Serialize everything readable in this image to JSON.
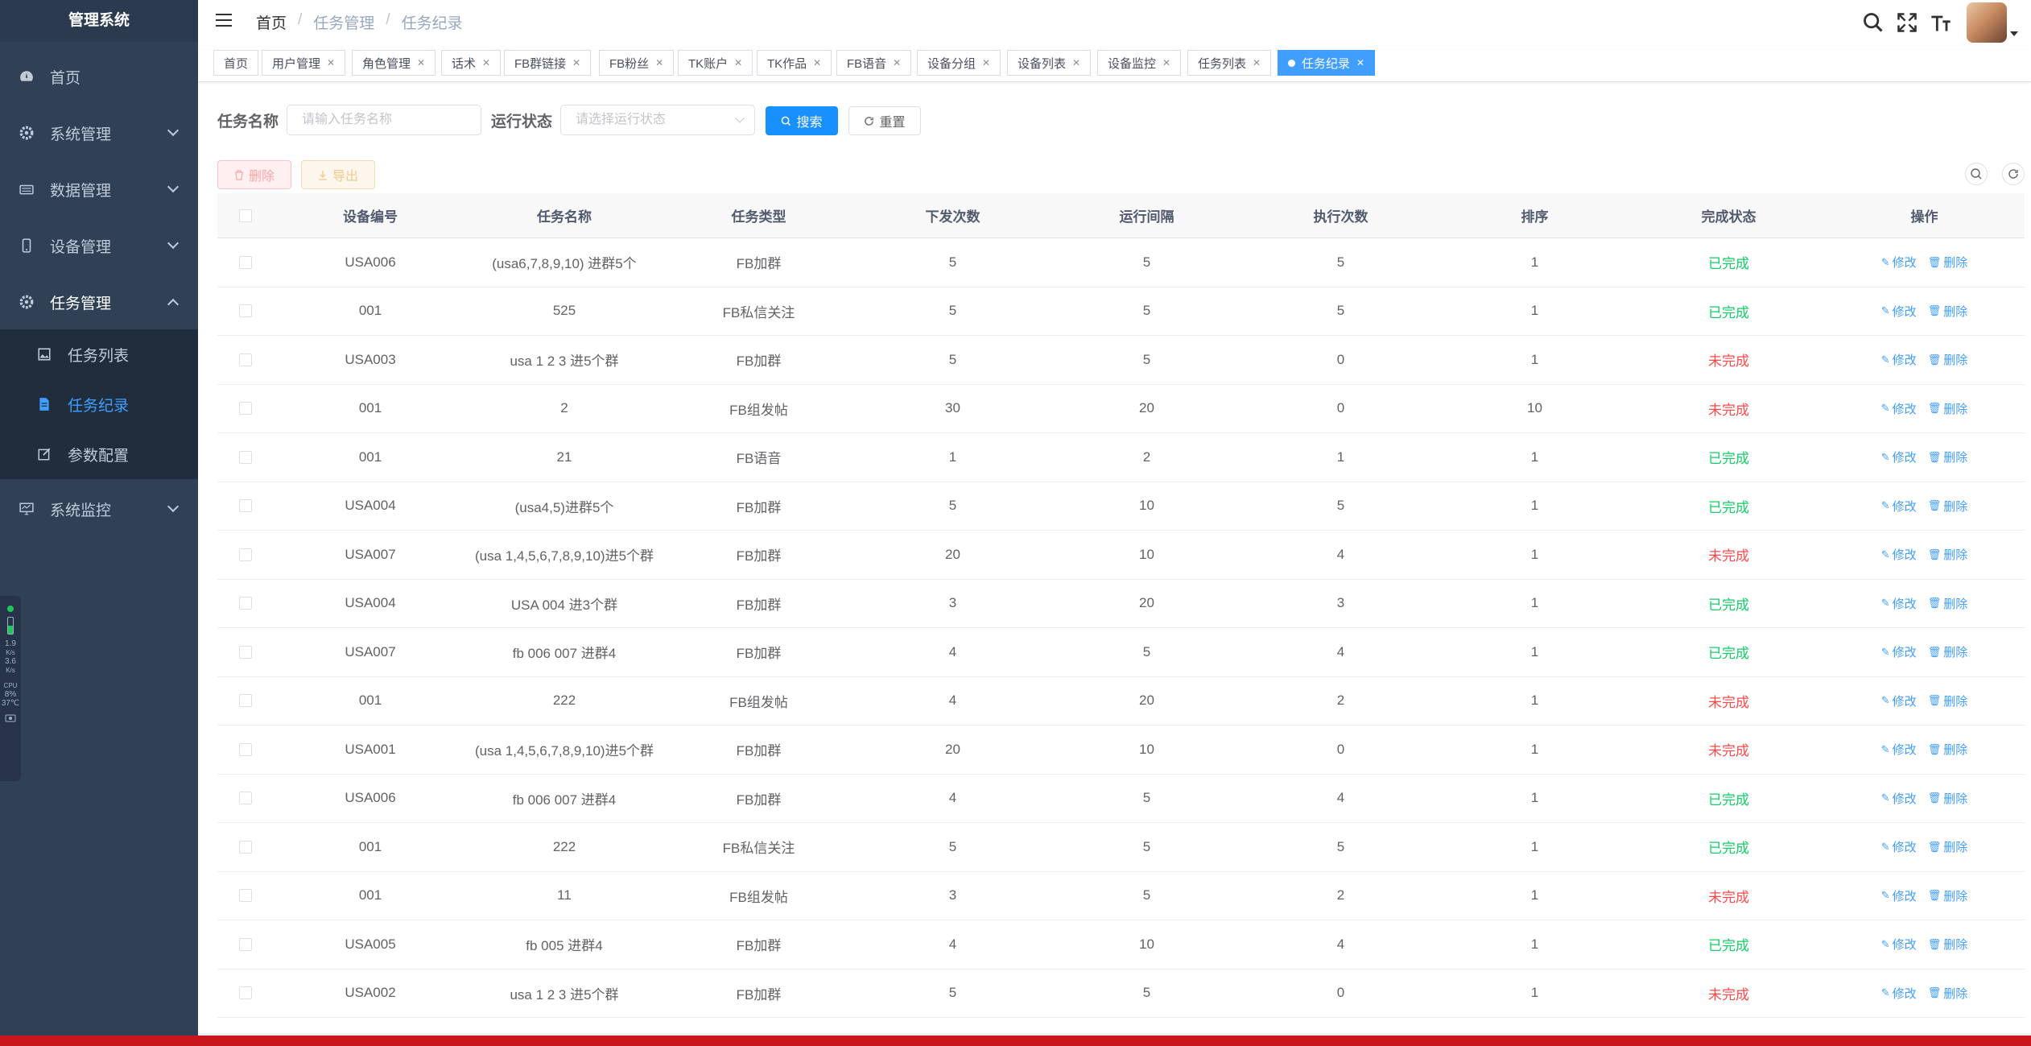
{
  "sidebar": {
    "title": "管理系统",
    "items": [
      {
        "label": "首页",
        "icon": "dashboard-icon"
      },
      {
        "label": "系统管理",
        "icon": "gear-icon"
      },
      {
        "label": "数据管理",
        "icon": "keyboard-icon"
      },
      {
        "label": "设备管理",
        "icon": "phone-icon"
      },
      {
        "label": "任务管理",
        "icon": "gear-icon"
      },
      {
        "label": "系统监控",
        "icon": "monitor-icon"
      }
    ],
    "subitems": [
      {
        "label": "任务列表"
      },
      {
        "label": "任务纪录"
      },
      {
        "label": "参数配置"
      }
    ]
  },
  "widget": {
    "down_speed": "1.9",
    "down_unit": "K/s",
    "up_speed": "3.6",
    "up_unit": "K/s",
    "cpu_label": "CPU",
    "cpu_value": "8%",
    "temp": "37℃"
  },
  "header": {
    "breadcrumb": [
      "首页",
      "任务管理",
      "任务纪录"
    ]
  },
  "tags": [
    "首页",
    "用户管理",
    "角色管理",
    "话术",
    "FB群链接",
    "FB粉丝",
    "TK账户",
    "TK作品",
    "FB语音",
    "设备分组",
    "设备列表",
    "设备监控",
    "任务列表",
    "任务纪录"
  ],
  "search": {
    "task_name_label": "任务名称",
    "task_name_placeholder": "请输入任务名称",
    "status_label": "运行状态",
    "status_placeholder": "请选择运行状态",
    "search_button": "搜索",
    "reset_button": "重置"
  },
  "toolbar": {
    "delete_button": "删除",
    "export_button": "导出"
  },
  "table": {
    "columns": [
      "设备编号",
      "任务名称",
      "任务类型",
      "下发次数",
      "运行间隔",
      "执行次数",
      "排序",
      "完成状态",
      "操作"
    ],
    "edit_label": "修改",
    "delete_label": "删除",
    "rows": [
      {
        "device": "USA006",
        "name": "(usa6,7,8,9,10) 进群5个",
        "type": "FB加群",
        "issued": "5",
        "interval": "5",
        "executed": "5",
        "order": "1",
        "status": "已完成",
        "done": true
      },
      {
        "device": "001",
        "name": "525",
        "type": "FB私信关注",
        "issued": "5",
        "interval": "5",
        "executed": "5",
        "order": "1",
        "status": "已完成",
        "done": true
      },
      {
        "device": "USA003",
        "name": "usa 1 2 3 进5个群",
        "type": "FB加群",
        "issued": "5",
        "interval": "5",
        "executed": "0",
        "order": "1",
        "status": "未完成",
        "done": false
      },
      {
        "device": "001",
        "name": "2",
        "type": "FB组发帖",
        "issued": "30",
        "interval": "20",
        "executed": "0",
        "order": "10",
        "status": "未完成",
        "done": false
      },
      {
        "device": "001",
        "name": "21",
        "type": "FB语音",
        "issued": "1",
        "interval": "2",
        "executed": "1",
        "order": "1",
        "status": "已完成",
        "done": true
      },
      {
        "device": "USA004",
        "name": "(usa4,5)进群5个",
        "type": "FB加群",
        "issued": "5",
        "interval": "10",
        "executed": "5",
        "order": "1",
        "status": "已完成",
        "done": true
      },
      {
        "device": "USA007",
        "name": "(usa 1,4,5,6,7,8,9,10)进5个群",
        "type": "FB加群",
        "issued": "20",
        "interval": "10",
        "executed": "4",
        "order": "1",
        "status": "未完成",
        "done": false
      },
      {
        "device": "USA004",
        "name": "USA 004 进3个群",
        "type": "FB加群",
        "issued": "3",
        "interval": "20",
        "executed": "3",
        "order": "1",
        "status": "已完成",
        "done": true
      },
      {
        "device": "USA007",
        "name": "fb 006 007 进群4",
        "type": "FB加群",
        "issued": "4",
        "interval": "5",
        "executed": "4",
        "order": "1",
        "status": "已完成",
        "done": true
      },
      {
        "device": "001",
        "name": "222",
        "type": "FB组发帖",
        "issued": "4",
        "interval": "20",
        "executed": "2",
        "order": "1",
        "status": "未完成",
        "done": false
      },
      {
        "device": "USA001",
        "name": "(usa 1,4,5,6,7,8,9,10)进5个群",
        "type": "FB加群",
        "issued": "20",
        "interval": "10",
        "executed": "0",
        "order": "1",
        "status": "未完成",
        "done": false
      },
      {
        "device": "USA006",
        "name": "fb 006 007 进群4",
        "type": "FB加群",
        "issued": "4",
        "interval": "5",
        "executed": "4",
        "order": "1",
        "status": "已完成",
        "done": true
      },
      {
        "device": "001",
        "name": "222",
        "type": "FB私信关注",
        "issued": "5",
        "interval": "5",
        "executed": "5",
        "order": "1",
        "status": "已完成",
        "done": true
      },
      {
        "device": "001",
        "name": "11",
        "type": "FB组发帖",
        "issued": "3",
        "interval": "5",
        "executed": "2",
        "order": "1",
        "status": "未完成",
        "done": false
      },
      {
        "device": "USA005",
        "name": "fb 005 进群4",
        "type": "FB加群",
        "issued": "4",
        "interval": "10",
        "executed": "4",
        "order": "1",
        "status": "已完成",
        "done": true
      },
      {
        "device": "USA002",
        "name": "usa 1 2 3 进5个群",
        "type": "FB加群",
        "issued": "5",
        "interval": "5",
        "executed": "0",
        "order": "1",
        "status": "未完成",
        "done": false
      }
    ]
  },
  "colors": {
    "primary": "#1890ff",
    "sidebar_bg": "#304156",
    "done": "#13ce66",
    "undone": "#ff4949",
    "taskbar": "#c8141b"
  }
}
